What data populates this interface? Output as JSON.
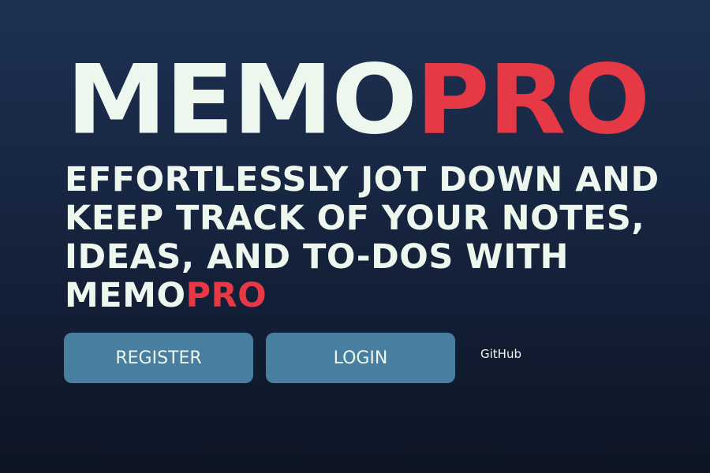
{
  "logo": {
    "part1": "MEMO",
    "part2": "PRO"
  },
  "tagline": {
    "text": "EFFORTLESSLY JOT DOWN AND KEEP TRACK OF YOUR NOTES, IDEAS, AND TO-DOS WITH ",
    "brand1": "MEMO",
    "brand2": "PRO"
  },
  "actions": {
    "register": "REGISTER",
    "login": "LOGIN",
    "github": "GitHub"
  },
  "colors": {
    "accent": "#e63946",
    "button": "#487fa0",
    "text": "#eef7ee"
  }
}
